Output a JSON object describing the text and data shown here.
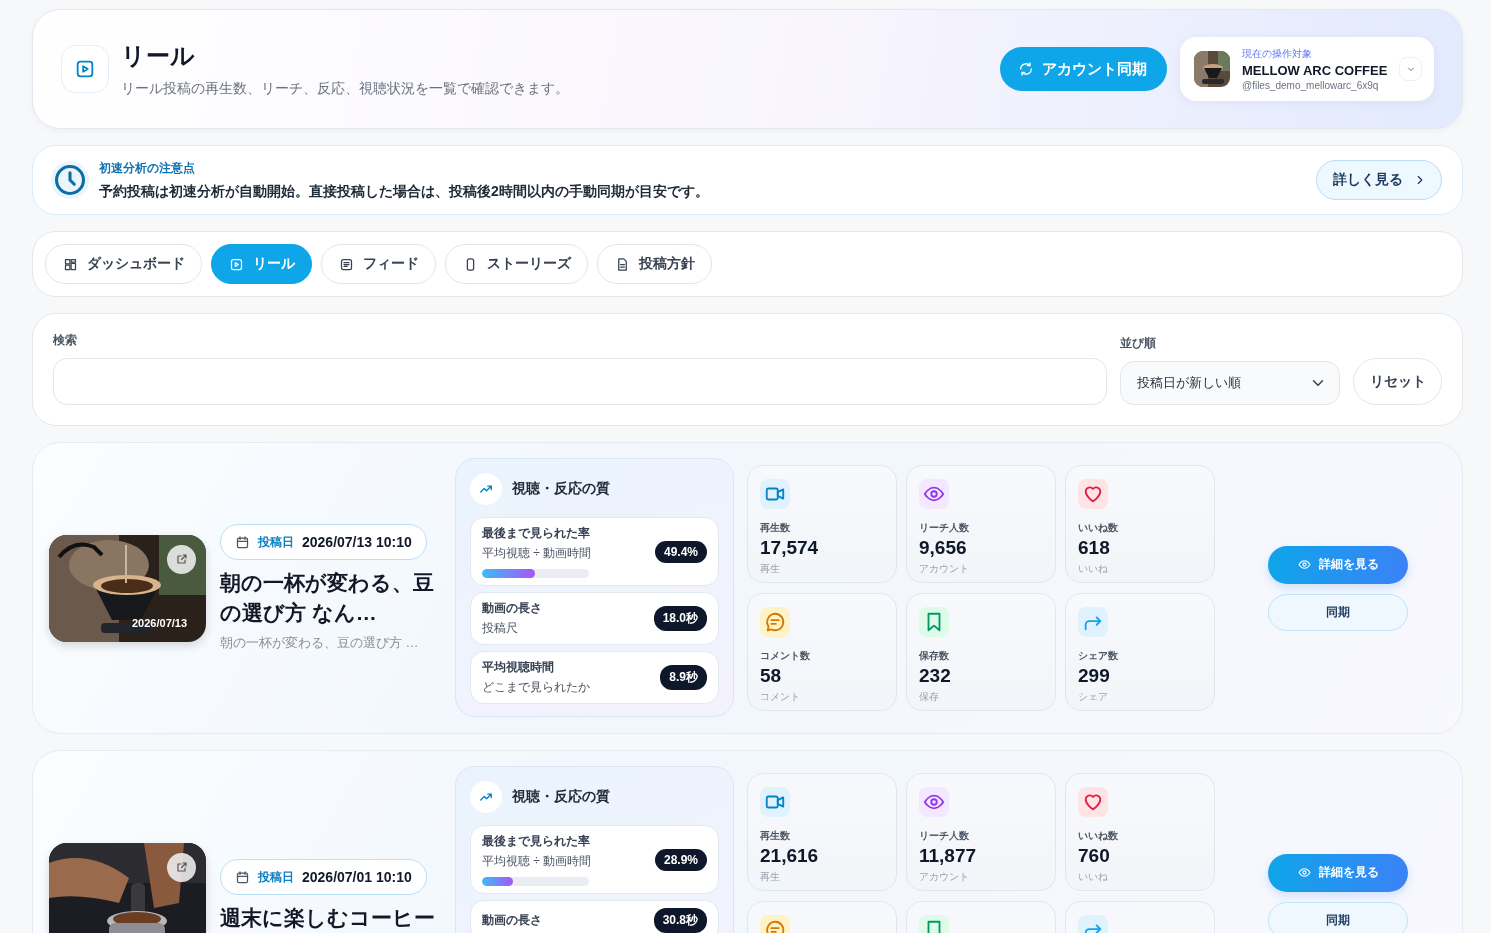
{
  "header": {
    "title": "リール",
    "subtitle": "リール投稿の再生数、リーチ、反応、視聴状況を一覧で確認できます。",
    "sync_button": "アカウント同期",
    "account": {
      "caption": "現在の操作対象",
      "name": "MELLOW ARC COFFEE",
      "handle": "@files_demo_mellowarc_6x9q"
    }
  },
  "notice": {
    "title": "初速分析の注意点",
    "body": "予約投稿は初速分析が自動開始。直接投稿した場合は、投稿後2時間以内の手動同期が目安です。",
    "button": "詳しく見る"
  },
  "tabs": [
    {
      "label": "ダッシュボード",
      "kind": "dashboard",
      "selected": false
    },
    {
      "label": "リール",
      "kind": "reel",
      "selected": true
    },
    {
      "label": "フィード",
      "kind": "feed",
      "selected": false
    },
    {
      "label": "ストーリーズ",
      "kind": "stories",
      "selected": false
    },
    {
      "label": "投稿方針",
      "kind": "policy",
      "selected": false
    }
  ],
  "filters": {
    "search_label": "検索",
    "sort_label": "並び順",
    "sort_value": "投稿日が新しい順",
    "reset_button": "リセット"
  },
  "reels": [
    {
      "thumbnail_date": "2026/07/13",
      "date_label": "投稿日",
      "date": "2026/07/13 10:10",
      "title": "朝の一杯が変わる、豆の選び方 なん…",
      "excerpt": "朝の一杯が変わる、豆の選び方 …",
      "quality": {
        "title": "視聴・反応の質",
        "metrics": [
          {
            "label": "最後まで見られた率",
            "note": "平均視聴 ÷ 動画時間",
            "value": "49.4%",
            "level": 0.494
          },
          {
            "label": "動画の長さ",
            "note": "投稿尺",
            "value": "18.0秒"
          },
          {
            "label": "平均視聴時間",
            "note": "どこまで見られたか",
            "value": "8.9秒"
          }
        ]
      },
      "stats": [
        {
          "kind": "plays",
          "label": "再生数",
          "value": "17,574",
          "unit": "再生"
        },
        {
          "kind": "reach",
          "label": "リーチ人数",
          "value": "9,656",
          "unit": "アカウント"
        },
        {
          "kind": "likes",
          "label": "いいね数",
          "value": "618",
          "unit": "いいね"
        },
        {
          "kind": "comments",
          "label": "コメント数",
          "value": "58",
          "unit": "コメント"
        },
        {
          "kind": "saves",
          "label": "保存数",
          "value": "232",
          "unit": "保存"
        },
        {
          "kind": "shares",
          "label": "シェア数",
          "value": "299",
          "unit": "シェア"
        }
      ],
      "detail_button": "詳細を見る",
      "sync_button": "同期"
    },
    {
      "date_label": "投稿日",
      "date": "2026/07/01 10:10",
      "title": "週末に楽しむコーヒー",
      "quality": {
        "title": "視聴・反応の質",
        "metrics": [
          {
            "label": "最後まで見られた率",
            "note": "平均視聴 ÷ 動画時間",
            "value": "28.9%",
            "level": 0.289
          },
          {
            "label": "動画の長さ",
            "value": "30.8秒"
          }
        ]
      },
      "stats": [
        {
          "kind": "plays",
          "label": "再生数",
          "value": "21,616",
          "unit": "再生"
        },
        {
          "kind": "reach",
          "label": "リーチ人数",
          "value": "11,877",
          "unit": "アカウント"
        },
        {
          "kind": "likes",
          "label": "いいね数",
          "value": "760",
          "unit": "いいね"
        },
        {
          "kind": "comments"
        },
        {
          "kind": "saves"
        },
        {
          "kind": "shares"
        }
      ],
      "detail_button": "詳細を見る",
      "sync_button": "同期"
    }
  ]
}
